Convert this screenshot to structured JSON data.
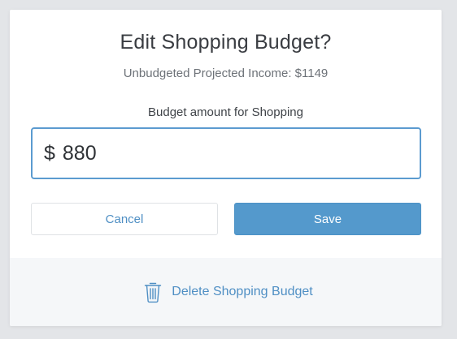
{
  "modal": {
    "title": "Edit Shopping Budget?",
    "subtitle": "Unbudgeted Projected Income: $1149",
    "field_label": "Budget amount for Shopping",
    "amount": {
      "currency_symbol": "$",
      "value": "880"
    },
    "cancel_label": "Cancel",
    "save_label": "Save",
    "delete_label": "Delete Shopping Budget",
    "delete_icon": "trash-icon"
  },
  "colors": {
    "accent": "#5499cc",
    "link": "#4f8fc4",
    "title_text": "#3a3d42",
    "muted_text": "#6d7278",
    "footer_bg": "#f5f7f9",
    "backdrop": "#e3e5e8"
  }
}
